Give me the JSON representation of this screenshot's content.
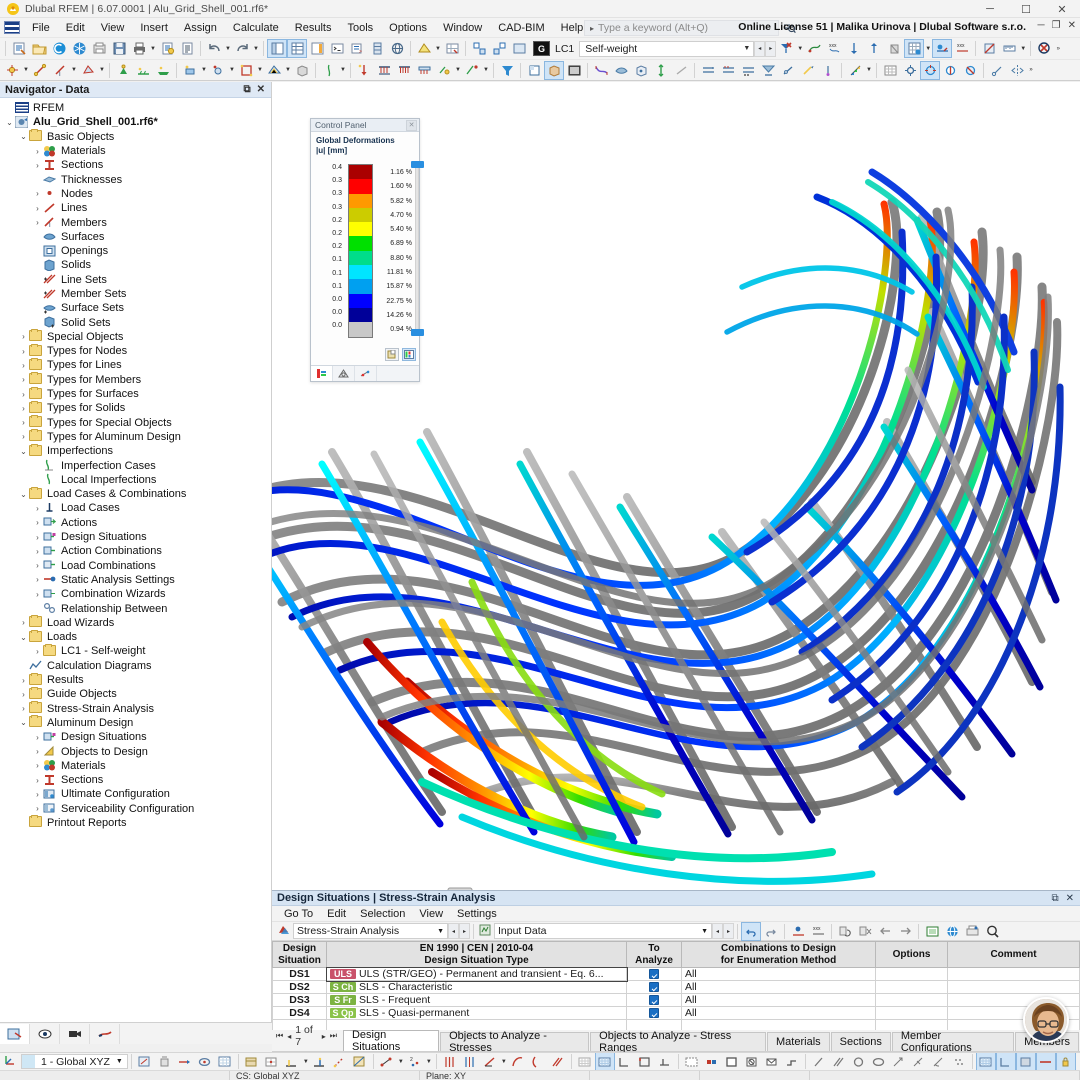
{
  "window": {
    "title": "Dlubal RFEM | 6.07.0001 | Alu_Grid_Shell_001.rf6*",
    "minimize": "─",
    "maximize": "☐",
    "close": "✕"
  },
  "menubar": {
    "items": [
      "File",
      "Edit",
      "View",
      "Insert",
      "Assign",
      "Calculate",
      "Results",
      "Tools",
      "Options",
      "Window",
      "CAD-BIM",
      "Help"
    ],
    "keyword_placeholder": "Type a keyword (Alt+Q)",
    "license": "Online License 51 | Malika Urinova | Dlubal Software s.r.o.",
    "doc_min": "─",
    "doc_restore": "❐",
    "doc_close": "✕"
  },
  "toolbar": {
    "load_case_badge": "G",
    "load_case_id": "LC1",
    "load_case_name": "Self-weight",
    "chevron": "˅",
    "prev": "◂",
    "next": "▸",
    "overflow": "»"
  },
  "navigator": {
    "title": "Navigator - Data",
    "undock": "⧉",
    "close": "✕",
    "root": "RFEM",
    "tree": [
      {
        "level": 0,
        "exp": "",
        "icon": "rfem-icon",
        "label": "RFEM",
        "bold": false
      },
      {
        "level": 0,
        "exp": "⌄",
        "icon": "model-icon",
        "label": "Alu_Grid_Shell_001.rf6*",
        "bold": true
      },
      {
        "level": 1,
        "exp": "⌄",
        "icon": "folder-icon",
        "label": "Basic Objects",
        "bold": false
      },
      {
        "level": 2,
        "exp": "›",
        "icon": "materials-icon",
        "label": "Materials",
        "bold": false
      },
      {
        "level": 2,
        "exp": "›",
        "icon": "sections-icon",
        "label": "Sections",
        "bold": false
      },
      {
        "level": 2,
        "exp": "",
        "icon": "thicknesses-icon",
        "label": "Thicknesses",
        "bold": false
      },
      {
        "level": 2,
        "exp": "›",
        "icon": "nodes-icon",
        "label": "Nodes",
        "bold": false
      },
      {
        "level": 2,
        "exp": "›",
        "icon": "lines-icon",
        "label": "Lines",
        "bold": false
      },
      {
        "level": 2,
        "exp": "›",
        "icon": "members-icon",
        "label": "Members",
        "bold": false
      },
      {
        "level": 2,
        "exp": "",
        "icon": "surfaces-icon",
        "label": "Surfaces",
        "bold": false
      },
      {
        "level": 2,
        "exp": "",
        "icon": "openings-icon",
        "label": "Openings",
        "bold": false
      },
      {
        "level": 2,
        "exp": "",
        "icon": "solids-icon",
        "label": "Solids",
        "bold": false
      },
      {
        "level": 2,
        "exp": "",
        "icon": "line-sets-icon",
        "label": "Line Sets",
        "bold": false
      },
      {
        "level": 2,
        "exp": "",
        "icon": "member-sets-icon",
        "label": "Member Sets",
        "bold": false
      },
      {
        "level": 2,
        "exp": "",
        "icon": "surface-sets-icon",
        "label": "Surface Sets",
        "bold": false
      },
      {
        "level": 2,
        "exp": "",
        "icon": "solid-sets-icon",
        "label": "Solid Sets",
        "bold": false
      },
      {
        "level": 1,
        "exp": "›",
        "icon": "folder-icon",
        "label": "Special Objects",
        "bold": false
      },
      {
        "level": 1,
        "exp": "›",
        "icon": "folder-icon",
        "label": "Types for Nodes",
        "bold": false
      },
      {
        "level": 1,
        "exp": "›",
        "icon": "folder-icon",
        "label": "Types for Lines",
        "bold": false
      },
      {
        "level": 1,
        "exp": "›",
        "icon": "folder-icon",
        "label": "Types for Members",
        "bold": false
      },
      {
        "level": 1,
        "exp": "›",
        "icon": "folder-icon",
        "label": "Types for Surfaces",
        "bold": false
      },
      {
        "level": 1,
        "exp": "›",
        "icon": "folder-icon",
        "label": "Types for Solids",
        "bold": false
      },
      {
        "level": 1,
        "exp": "›",
        "icon": "folder-icon",
        "label": "Types for Special Objects",
        "bold": false
      },
      {
        "level": 1,
        "exp": "›",
        "icon": "folder-icon",
        "label": "Types for Aluminum Design",
        "bold": false
      },
      {
        "level": 1,
        "exp": "⌄",
        "icon": "folder-icon",
        "label": "Imperfections",
        "bold": false
      },
      {
        "level": 2,
        "exp": "",
        "icon": "imperfection-case-icon",
        "label": "Imperfection Cases",
        "bold": false
      },
      {
        "level": 2,
        "exp": "",
        "icon": "local-imperfection-icon",
        "label": "Local Imperfections",
        "bold": false
      },
      {
        "level": 1,
        "exp": "⌄",
        "icon": "folder-icon",
        "label": "Load Cases & Combinations",
        "bold": false
      },
      {
        "level": 2,
        "exp": "›",
        "icon": "load-cases-icon",
        "label": "Load Cases",
        "bold": false
      },
      {
        "level": 2,
        "exp": "›",
        "icon": "actions-icon",
        "label": "Actions",
        "bold": false
      },
      {
        "level": 2,
        "exp": "›",
        "icon": "design-situations-icon",
        "label": "Design Situations",
        "bold": false
      },
      {
        "level": 2,
        "exp": "›",
        "icon": "action-combinations-icon",
        "label": "Action Combinations",
        "bold": false
      },
      {
        "level": 2,
        "exp": "›",
        "icon": "load-combinations-icon",
        "label": "Load Combinations",
        "bold": false
      },
      {
        "level": 2,
        "exp": "›",
        "icon": "static-analysis-icon",
        "label": "Static Analysis Settings",
        "bold": false
      },
      {
        "level": 2,
        "exp": "›",
        "icon": "combination-wizards-icon",
        "label": "Combination Wizards",
        "bold": false
      },
      {
        "level": 2,
        "exp": "",
        "icon": "relationship-icon",
        "label": "Relationship Between",
        "bold": false
      },
      {
        "level": 1,
        "exp": "›",
        "icon": "folder-icon",
        "label": "Load Wizards",
        "bold": false
      },
      {
        "level": 1,
        "exp": "⌄",
        "icon": "folder-icon",
        "label": "Loads",
        "bold": false
      },
      {
        "level": 2,
        "exp": "›",
        "icon": "folder-icon",
        "label": "LC1 - Self-weight",
        "bold": false
      },
      {
        "level": 1,
        "exp": "",
        "icon": "calculation-diagrams-icon",
        "label": "Calculation Diagrams",
        "bold": false
      },
      {
        "level": 1,
        "exp": "›",
        "icon": "folder-icon",
        "label": "Results",
        "bold": false
      },
      {
        "level": 1,
        "exp": "›",
        "icon": "folder-icon",
        "label": "Guide Objects",
        "bold": false
      },
      {
        "level": 1,
        "exp": "›",
        "icon": "folder-icon",
        "label": "Stress-Strain Analysis",
        "bold": false
      },
      {
        "level": 1,
        "exp": "⌄",
        "icon": "folder-icon",
        "label": "Aluminum Design",
        "bold": false
      },
      {
        "level": 2,
        "exp": "›",
        "icon": "design-situations-icon",
        "label": "Design Situations",
        "bold": false
      },
      {
        "level": 2,
        "exp": "›",
        "icon": "objects-to-design-icon",
        "label": "Objects to Design",
        "bold": false
      },
      {
        "level": 2,
        "exp": "›",
        "icon": "materials-icon",
        "label": "Materials",
        "bold": false
      },
      {
        "level": 2,
        "exp": "›",
        "icon": "sections-icon",
        "label": "Sections",
        "bold": false
      },
      {
        "level": 2,
        "exp": "›",
        "icon": "ultimate-config-icon",
        "label": "Ultimate Configuration",
        "bold": false
      },
      {
        "level": 2,
        "exp": "›",
        "icon": "serviceability-config-icon",
        "label": "Serviceability Configuration",
        "bold": false
      },
      {
        "level": 1,
        "exp": "",
        "icon": "folder-icon",
        "label": "Printout Reports",
        "bold": false
      }
    ]
  },
  "control_panel": {
    "header": "Control Panel",
    "close": "✕",
    "title_line1": "Global Deformations",
    "title_line2": "|u| [mm]",
    "scale_labels": [
      "0.4",
      "0.3",
      "0.3",
      "0.3",
      "0.2",
      "0.2",
      "0.2",
      "0.1",
      "0.1",
      "0.1",
      "0.0",
      "0.0",
      "0.0"
    ],
    "colors": [
      "#aa0000",
      "#ff0000",
      "#ff9900",
      "#cccc00",
      "#ffff00",
      "#00e000",
      "#00dd8a",
      "#00e5ff",
      "#00a0f0",
      "#0000ff",
      "#000099",
      "#c8c8c8"
    ],
    "percents": [
      "1.16 %",
      "1.60 %",
      "5.82 %",
      "4.70 %",
      "5.40 %",
      "6.89 %",
      "8.80 %",
      "11.81 %",
      "15.87 %",
      "22.75 %",
      "14.26 %",
      "0.94 %"
    ]
  },
  "table_panel": {
    "header": "Design Situations | Stress-Strain Analysis",
    "undock": "⧉",
    "close": "✕",
    "menu": [
      "Go To",
      "Edit",
      "Selection",
      "View",
      "Settings"
    ],
    "module_combo": "Stress-Strain Analysis",
    "data_combo": "Input Data",
    "chevron": "˅",
    "prev": "◂",
    "next": "▸",
    "columns": {
      "design_situation": "Design\nSituation",
      "standard_line1": "EN 1990 | CEN | 2010-04",
      "standard_line2": "Design Situation Type",
      "to_analyze": "To\nAnalyze",
      "combinations_line1": "Combinations to Design",
      "combinations_line2": "for Enumeration Method",
      "options": "Options",
      "comment": "Comment"
    },
    "rows": [
      {
        "id": "DS1",
        "tag": "ULS",
        "tag_color": "#c9526a",
        "type": "ULS (STR/GEO) - Permanent and transient - Eq. 6...",
        "analyze": true,
        "combinations": "All",
        "options": "",
        "comment": ""
      },
      {
        "id": "DS2",
        "tag": "S Ch",
        "tag_color": "#7cb342",
        "type": "SLS - Characteristic",
        "analyze": true,
        "combinations": "All",
        "options": "",
        "comment": ""
      },
      {
        "id": "DS3",
        "tag": "S Fr",
        "tag_color": "#7cb342",
        "type": "SLS - Frequent",
        "analyze": true,
        "combinations": "All",
        "options": "",
        "comment": ""
      },
      {
        "id": "DS4",
        "tag": "S Qp",
        "tag_color": "#8bc34a",
        "type": "SLS - Quasi-permanent",
        "analyze": true,
        "combinations": "All",
        "options": "",
        "comment": ""
      }
    ]
  },
  "tabstrip": {
    "page_label": "1 of 7",
    "first": "⏮",
    "prev": "◂",
    "next": "▸",
    "last": "⏭",
    "tabs": [
      {
        "label": "Design Situations",
        "active": true
      },
      {
        "label": "Objects to Analyze - Stresses",
        "active": false
      },
      {
        "label": "Objects to Analyze - Stress Ranges",
        "active": false
      },
      {
        "label": "Materials",
        "active": false
      },
      {
        "label": "Sections",
        "active": false
      },
      {
        "label": "Member Configurations",
        "active": false
      },
      {
        "label": "Members",
        "active": false
      }
    ]
  },
  "navtabs": {
    "items": [
      "data-navigator-tab",
      "display-navigator-tab",
      "views-navigator-tab",
      "results-navigator-tab"
    ]
  },
  "statusbar": {
    "coord_system": "1 - Global XYZ",
    "chevron": "˅",
    "cs_text": "CS: Global XYZ",
    "plane_text": "Plane: XY"
  }
}
